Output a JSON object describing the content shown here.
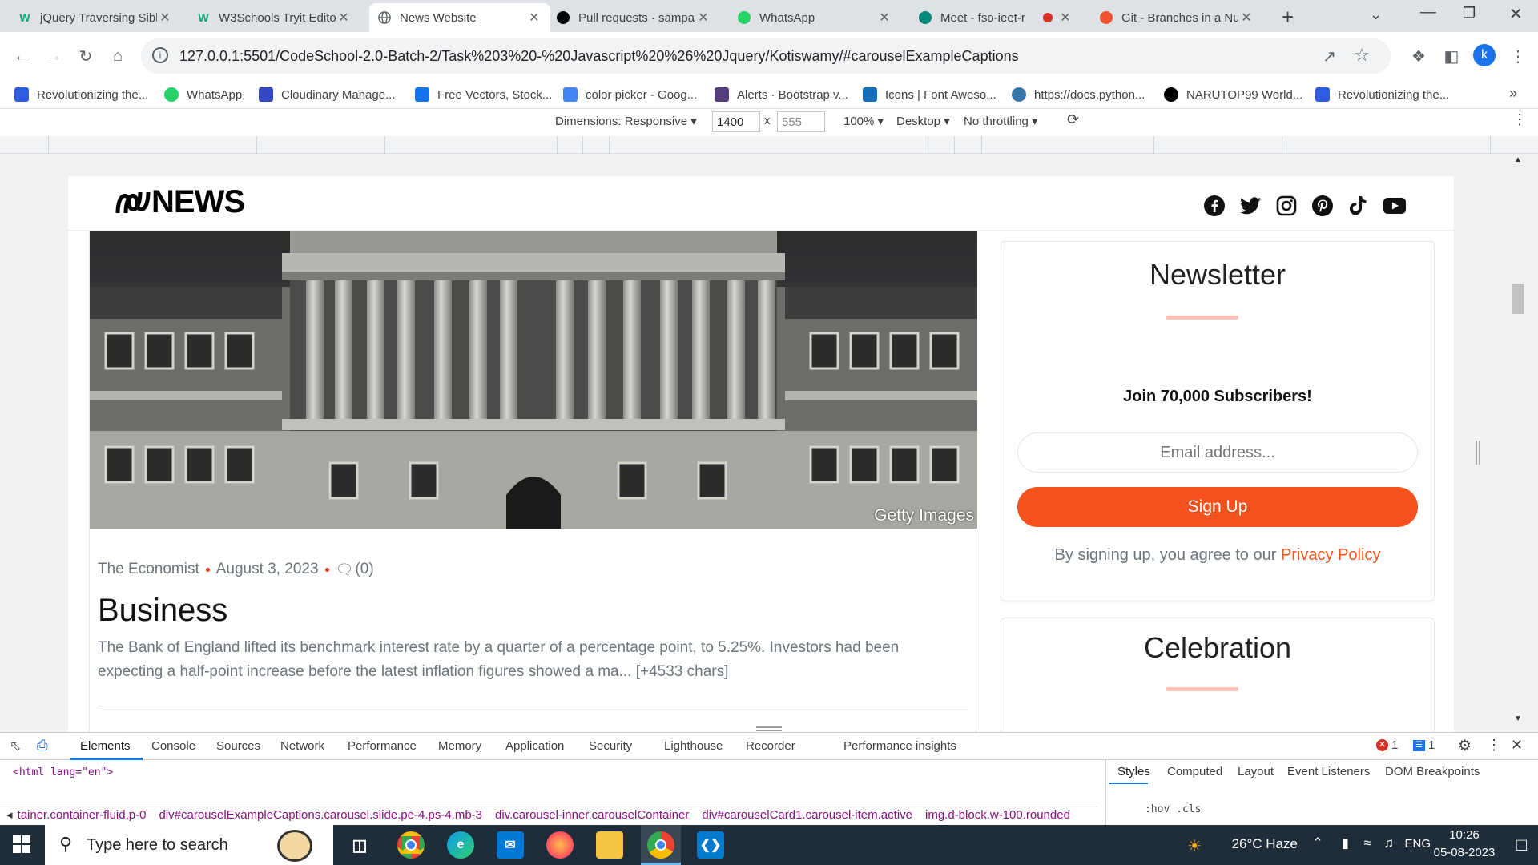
{
  "browser": {
    "tabs": [
      {
        "title": "jQuery Traversing Sibl",
        "icon": "W",
        "icon_color": "#04aa6d",
        "active": false
      },
      {
        "title": "W3Schools Tryit Edito",
        "icon": "W",
        "icon_color": "#04aa6d",
        "active": false
      },
      {
        "title": "News Website",
        "icon": "globe",
        "icon_color": "#5f6368",
        "active": true
      },
      {
        "title": "Pull requests · sampat",
        "icon": "github",
        "icon_color": "#000000",
        "active": false
      },
      {
        "title": "WhatsApp",
        "icon": "whatsapp",
        "icon_color": "#25d366",
        "active": false
      },
      {
        "title": "Meet - fso-ieet-r",
        "icon": "meet",
        "icon_color": "#00897b",
        "active": false
      },
      {
        "title": "Git - Branches in a Nu",
        "icon": "git",
        "icon_color": "#f05133",
        "active": false
      }
    ],
    "new_tab": "+",
    "url": "127.0.0.1:5501/CodeSchool-2.0-Batch-2/Task%203%20-%20Javascript%20%26%20Jquery/Kotiswamy/#carouselExampleCaptions",
    "profile_letter": "k"
  },
  "bookmarks": [
    {
      "label": "Revolutionizing the...",
      "icon": "wix",
      "color": "#2d5be3"
    },
    {
      "label": "WhatsApp",
      "icon": "whatsapp",
      "color": "#25d366"
    },
    {
      "label": "Cloudinary Manage...",
      "icon": "cloudinary",
      "color": "#3448c5"
    },
    {
      "label": "Free Vectors, Stock...",
      "icon": "freepik",
      "color": "#1273eb"
    },
    {
      "label": "color picker - Goog...",
      "icon": "google",
      "color": "#4285f4"
    },
    {
      "label": "Alerts · Bootstrap v...",
      "icon": "bootstrap",
      "color": "#563d7c"
    },
    {
      "label": "Icons | Font Aweso...",
      "icon": "flag",
      "color": "#146ebe"
    },
    {
      "label": "https://docs.python...",
      "icon": "python",
      "color": "#3776ab"
    },
    {
      "label": "NARUTOP99 World...",
      "icon": "github",
      "color": "#000000"
    },
    {
      "label": "Revolutionizing the...",
      "icon": "wix",
      "color": "#2d5be3"
    }
  ],
  "device_toolbar": {
    "dimensions_label": "Dimensions: Responsive",
    "width": "1400",
    "height": "555",
    "times": "x",
    "zoom": "100%",
    "mode": "Desktop",
    "throttling": "No throttling"
  },
  "site": {
    "logo": "NEWS",
    "social": [
      "facebook",
      "twitter",
      "instagram",
      "pinterest",
      "tiktok",
      "youtube"
    ],
    "article": {
      "image_credit": "Getty Images",
      "source": "The Economist",
      "date": "August 3, 2023",
      "comments": "(0)",
      "title": "Business",
      "description": "The Bank of England lifted its benchmark interest rate by a quarter of a percentage point, to 5.25%. Investors had been expecting a half-point increase before the latest inflation figures showed a ma... [+4533 chars]"
    },
    "newsletter": {
      "title": "Newsletter",
      "subtitle": "Join 70,000 Subscribers!",
      "email_placeholder": "Email address...",
      "button": "Sign Up",
      "terms": "By signing up, you agree to our",
      "privacy": "Privacy Policy",
      "accent": "#f4511e"
    },
    "celebration": {
      "title": "Celebration"
    }
  },
  "devtools": {
    "tabs": [
      "Elements",
      "Console",
      "Sources",
      "Network",
      "Performance",
      "Memory",
      "Application",
      "Security",
      "Lighthouse",
      "Recorder",
      "Performance insights"
    ],
    "active_tab": "Elements",
    "errors": "1",
    "messages": "1",
    "html_line": "<html lang=\"en\">",
    "breadcrumbs": [
      "tainer.container-fluid.p-0",
      "div#carouselExampleCaptions.carousel.slide.pe-4.ps-4.mb-3",
      "div.carousel-inner.carouselContainer",
      "div#carouselCard1.carousel-item.active",
      "img.d-block.w-100.rounded"
    ],
    "side_tabs": [
      "Styles",
      "Computed",
      "Layout",
      "Event Listeners",
      "DOM Breakpoints"
    ],
    "filter": ":hov .cls"
  },
  "taskbar": {
    "search_placeholder": "Type here to search",
    "weather": "26°C Haze",
    "lang": "ENG",
    "time": "10:26",
    "date": "05-08-2023"
  }
}
